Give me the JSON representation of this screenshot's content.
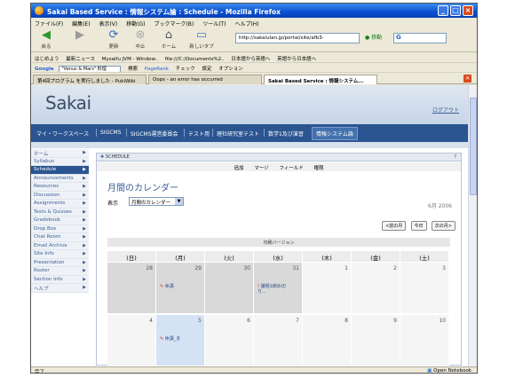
{
  "window": {
    "title": "Sakai Based Service : 情報システム論 : Schedule - Mozilla Firefox",
    "minimize": "_",
    "maximize": "□",
    "close": "×"
  },
  "menubar": [
    "ファイル(F)",
    "編集(E)",
    "表示(V)",
    "移動(G)",
    "ブックマーク(B)",
    "ツール(T)",
    "ヘルプ(H)"
  ],
  "nav": {
    "back": "戻る",
    "forward": "→",
    "reload": "更新",
    "stop": "中止",
    "home": "ホーム",
    "newtab": "新しいタブ",
    "address": "http://sakaiulan.jp/portal/site/afb3-",
    "go": "移動",
    "search_label": "G"
  },
  "bookmarks": [
    "はじめよう",
    "最新ニュース",
    "Mysaifu JVM - Window..",
    "file:///C:/Documents%2..",
    "日本語から英語へ",
    "英語から日本語へ"
  ],
  "googlebar": {
    "brand": "Google",
    "query": "\"Venus & Mars\" 料理",
    "items": [
      "検索",
      "PageRank",
      "チェック",
      "設定",
      "オプション"
    ]
  },
  "tabs": [
    {
      "label": "第4回プログラム を実行しました - PukiWiki"
    },
    {
      "label": "Oops - an error has occurred"
    },
    {
      "label": "Sakai Based Service : 情報システム..."
    }
  ],
  "sakai": {
    "logo": "Sakai",
    "logout": "ログアウト",
    "site_tabs": [
      "マイ・ワークスペース",
      "SIGCMS",
      "SIGCMS運営委員会",
      "テスト用",
      "理社研究室テスト",
      "数学1及び演習",
      "情報システム論"
    ],
    "left_nav": [
      "ホーム",
      "Syllabus",
      "Schedule",
      "Announcements",
      "Resources",
      "Discussion",
      "Assignments",
      "Tests & Quizzes",
      "Gradebook",
      "Drop Box",
      "Chat Room",
      "Email Archive",
      "Site Info",
      "Presentation",
      "Roster",
      "Section Info",
      "ヘルプ"
    ],
    "left_nav_selected": "Schedule"
  },
  "schedule": {
    "portlet_title": "SCHEDULE",
    "help": "?",
    "menu": [
      "追加",
      "マージ",
      "フィールド",
      "権限"
    ],
    "heading": "月間のカレンダー",
    "view_label": "表示",
    "view_value": "月間のカレンダー",
    "month": "6月 2006",
    "buttons": [
      "<前の月",
      "今日",
      "次の月>"
    ],
    "print_version": "印刷バージョン",
    "weekdays": [
      "(日)",
      "(月)",
      "(火)",
      "(水)",
      "(木)",
      "(金)",
      "(土)"
    ],
    "weeks": [
      [
        {
          "num": "28",
          "prev": true,
          "ev": ""
        },
        {
          "num": "29",
          "prev": true,
          "ev": "休講"
        },
        {
          "num": "30",
          "prev": true,
          "ev": ""
        },
        {
          "num": "31",
          "prev": true,
          "ev": "課題1締め切り..."
        },
        {
          "num": "1",
          "prev": false,
          "ev": ""
        },
        {
          "num": "2",
          "prev": false,
          "ev": ""
        },
        {
          "num": "3",
          "prev": false,
          "ev": ""
        }
      ],
      [
        {
          "num": "4",
          "prev": false,
          "ev": ""
        },
        {
          "num": "5",
          "prev": false,
          "ev": "休講_ま",
          "today": true
        },
        {
          "num": "6",
          "prev": false,
          "ev": ""
        },
        {
          "num": "7",
          "prev": false,
          "ev": ""
        },
        {
          "num": "8",
          "prev": false,
          "ev": ""
        },
        {
          "num": "9",
          "prev": false,
          "ev": ""
        },
        {
          "num": "10",
          "prev": false,
          "ev": ""
        }
      ]
    ]
  },
  "status": {
    "left": "完了",
    "right": "Open Notebook"
  }
}
